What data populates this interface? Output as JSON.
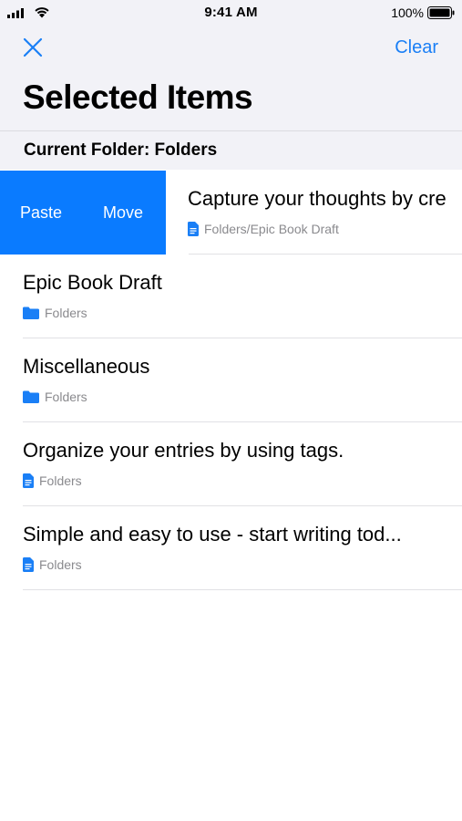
{
  "status_bar": {
    "time": "9:41 AM",
    "battery_percent": "100%"
  },
  "nav": {
    "clear_label": "Clear",
    "title": "Selected Items"
  },
  "section": {
    "header": "Current Folder: Folders"
  },
  "swiped_row": {
    "actions": {
      "paste": "Paste",
      "move": "Move"
    },
    "title": "Capture your thoughts by cre",
    "path": "Folders/Epic Book Draft",
    "icon": "document-icon"
  },
  "rows": [
    {
      "title": "Epic Book Draft",
      "path": "Folders",
      "icon": "folder-icon"
    },
    {
      "title": "Miscellaneous",
      "path": "Folders",
      "icon": "folder-icon"
    },
    {
      "title": "Organize your entries by using tags.",
      "path": "Folders",
      "icon": "document-icon"
    },
    {
      "title": "Simple and easy to use - start writing tod...",
      "path": "Folders",
      "icon": "document-icon"
    }
  ],
  "colors": {
    "accent": "#1a7ff6",
    "swipe_action_bg": "#0a7bff",
    "header_bg": "#f2f2f7"
  }
}
